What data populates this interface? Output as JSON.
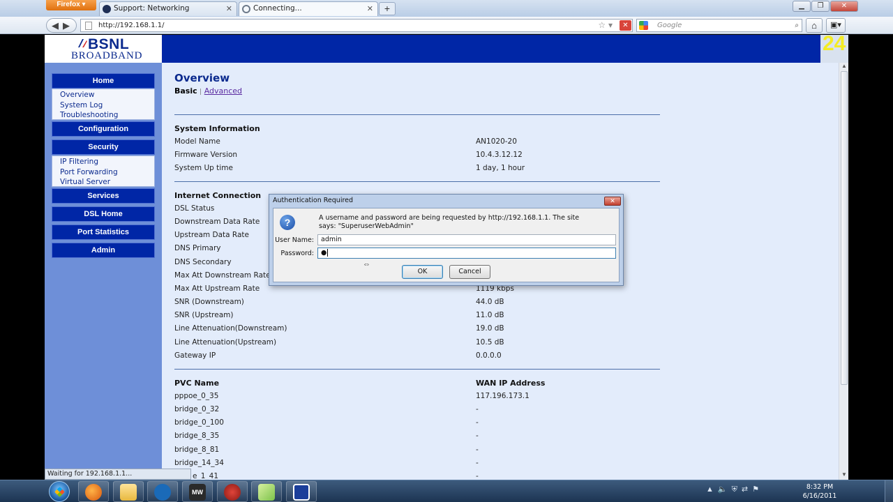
{
  "browser": {
    "menu_button": "Firefox",
    "tabs": [
      {
        "label": "Support: Networking"
      },
      {
        "label": "Connecting..."
      }
    ],
    "url": "http://192.168.1.1/",
    "search_placeholder": "Google",
    "status": "Waiting for 192.168.1.1..."
  },
  "brand": {
    "name": "BSNL",
    "sub": "BROADBAND",
    "corner_number": "24"
  },
  "sidebar": {
    "home": "Home",
    "home_items": [
      "Overview",
      "System Log",
      "Troubleshooting"
    ],
    "configuration": "Configuration",
    "security": "Security",
    "security_items": [
      "IP Filtering",
      "Port Forwarding",
      "Virtual Server"
    ],
    "services": "Services",
    "dsl_home": "DSL Home",
    "port_statistics": "Port Statistics",
    "admin": "Admin"
  },
  "main": {
    "title": "Overview",
    "tab_basic": "Basic",
    "tab_sep": "|",
    "tab_advanced": "Advanced",
    "system_info": {
      "heading": "System Information",
      "rows": [
        {
          "label": "Model Name",
          "value": "AN1020-20"
        },
        {
          "label": "Firmware Version",
          "value": "10.4.3.12.12"
        },
        {
          "label": "System Up time",
          "value": "1 day, 1 hour"
        }
      ]
    },
    "internet": {
      "heading": "Internet Connection",
      "rows": [
        {
          "label": "DSL Status",
          "value": ""
        },
        {
          "label": "Downstream Data Rate",
          "value": ""
        },
        {
          "label": "Upstream Data Rate",
          "value": ""
        },
        {
          "label": "DNS Primary",
          "value": ""
        },
        {
          "label": "DNS Secondary",
          "value": ""
        },
        {
          "label": "Max Att Downstream Rate",
          "value": ""
        },
        {
          "label": "Max Att Upstream Rate",
          "value": "1119 kbps"
        },
        {
          "label": "SNR (Downstream)",
          "value": "44.0 dB"
        },
        {
          "label": "SNR (Upstream)",
          "value": "11.0 dB"
        },
        {
          "label": "Line Attenuation(Downstream)",
          "value": "19.0 dB"
        },
        {
          "label": "Line Attenuation(Upstream)",
          "value": "10.5 dB"
        },
        {
          "label": "Gateway IP",
          "value": "0.0.0.0"
        }
      ]
    },
    "pvc": {
      "col1": "PVC Name",
      "col2": "WAN IP Address",
      "rows": [
        {
          "name": "pppoe_0_35",
          "ip": "117.196.173.1"
        },
        {
          "name": "bridge_0_32",
          "ip": "-"
        },
        {
          "name": "bridge_0_100",
          "ip": "-"
        },
        {
          "name": "bridge_8_35",
          "ip": "-"
        },
        {
          "name": "bridge_8_81",
          "ip": "-"
        },
        {
          "name": "bridge_14_34",
          "ip": "-"
        },
        {
          "name": "e_1_41",
          "ip": "-"
        }
      ]
    }
  },
  "dialog": {
    "title": "Authentication Required",
    "message": "A username and password are being requested by http://192.168.1.1. The site says: \"SuperuserWebAdmin\"",
    "user_label": "User Name:",
    "user_value": "admin",
    "password_label": "Password:",
    "password_value": "●",
    "ok": "OK",
    "cancel": "Cancel"
  },
  "taskbar": {
    "time": "8:32 PM",
    "date": "6/16/2011"
  }
}
